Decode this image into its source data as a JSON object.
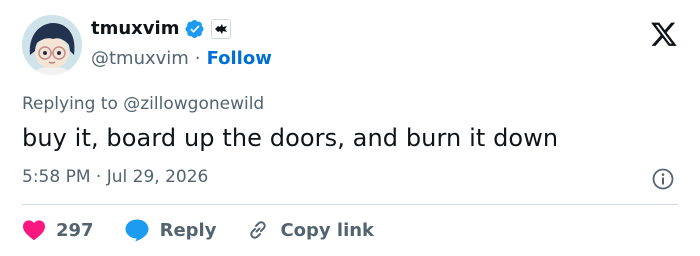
{
  "tweet": {
    "display_name": "tmuxvim",
    "handle": "@tmuxvim",
    "separator": "·",
    "follow_label": "Follow",
    "replying_prefix": "Replying to",
    "replying_to": "@zillowgonewild",
    "text": "buy it, board up the doors, and burn it down",
    "timestamp": "5:58 PM · Jul 29, 2026",
    "like_count": "297",
    "reply_label": "Reply",
    "copy_link_label": "Copy link"
  },
  "colors": {
    "text": "#0f1419",
    "secondary": "#536471",
    "follow": "#006fd6",
    "verified": "#1d9bf0",
    "like": "#f91880",
    "reply_bubble": "#1d9bf0",
    "divider": "#cfd9de"
  },
  "icons": [
    "verified-badge-icon",
    "affiliate-badge-icon",
    "x-logo-icon",
    "info-icon",
    "heart-icon",
    "reply-bubble-icon",
    "link-icon"
  ]
}
